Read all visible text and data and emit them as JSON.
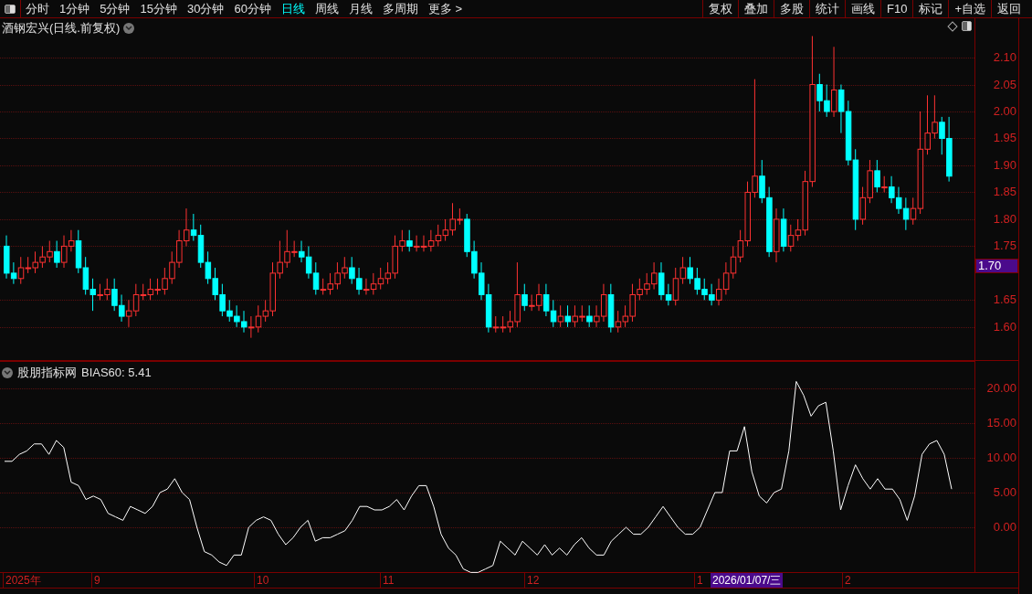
{
  "toolbar": {
    "periods": [
      {
        "label": "分时",
        "selected": false
      },
      {
        "label": "1分钟",
        "selected": false
      },
      {
        "label": "5分钟",
        "selected": false
      },
      {
        "label": "15分钟",
        "selected": false
      },
      {
        "label": "30分钟",
        "selected": false
      },
      {
        "label": "60分钟",
        "selected": false
      },
      {
        "label": "日线",
        "selected": true
      },
      {
        "label": "周线",
        "selected": false
      },
      {
        "label": "月线",
        "selected": false
      },
      {
        "label": "多周期",
        "selected": false
      },
      {
        "label": "更多 >",
        "selected": false
      }
    ],
    "actions": [
      "复权",
      "叠加",
      "多股",
      "统计",
      "画线",
      "F10",
      "标记",
      "+自选",
      "返回"
    ]
  },
  "price_pane": {
    "title": "酒钢宏兴(日线.前复权)",
    "current_price": "1.70",
    "chart_data": {
      "type": "candlestick",
      "grid": true,
      "ylim": [
        1.537,
        2.173
      ],
      "yticks": [
        {
          "value": 2.1,
          "label": "2.10"
        },
        {
          "value": 2.05,
          "label": "2.05"
        },
        {
          "value": 2.0,
          "label": "2.00"
        },
        {
          "value": 1.95,
          "label": "1.95"
        },
        {
          "value": 1.9,
          "label": "1.90"
        },
        {
          "value": 1.85,
          "label": "1.85"
        },
        {
          "value": 1.8,
          "label": "1.80"
        },
        {
          "value": 1.75,
          "label": "1.75"
        },
        {
          "value": 1.65,
          "label": "1.65"
        },
        {
          "value": 1.6,
          "label": "1.60"
        }
      ],
      "ohlc": [
        [
          1.75,
          1.77,
          1.69,
          1.7
        ],
        [
          1.7,
          1.72,
          1.68,
          1.69
        ],
        [
          1.69,
          1.73,
          1.68,
          1.71
        ],
        [
          1.71,
          1.73,
          1.7,
          1.71
        ],
        [
          1.71,
          1.74,
          1.7,
          1.72
        ],
        [
          1.72,
          1.75,
          1.71,
          1.73
        ],
        [
          1.73,
          1.76,
          1.72,
          1.74
        ],
        [
          1.74,
          1.76,
          1.71,
          1.72
        ],
        [
          1.72,
          1.77,
          1.71,
          1.75
        ],
        [
          1.75,
          1.78,
          1.74,
          1.76
        ],
        [
          1.76,
          1.78,
          1.7,
          1.71
        ],
        [
          1.71,
          1.73,
          1.66,
          1.67
        ],
        [
          1.67,
          1.69,
          1.63,
          1.66
        ],
        [
          1.66,
          1.68,
          1.65,
          1.66
        ],
        [
          1.66,
          1.69,
          1.65,
          1.67
        ],
        [
          1.67,
          1.69,
          1.63,
          1.64
        ],
        [
          1.64,
          1.66,
          1.61,
          1.62
        ],
        [
          1.62,
          1.65,
          1.6,
          1.63
        ],
        [
          1.63,
          1.68,
          1.62,
          1.66
        ],
        [
          1.66,
          1.68,
          1.65,
          1.66
        ],
        [
          1.66,
          1.69,
          1.65,
          1.67
        ],
        [
          1.67,
          1.69,
          1.66,
          1.67
        ],
        [
          1.67,
          1.71,
          1.66,
          1.69
        ],
        [
          1.69,
          1.74,
          1.68,
          1.72
        ],
        [
          1.72,
          1.78,
          1.71,
          1.76
        ],
        [
          1.76,
          1.82,
          1.75,
          1.78
        ],
        [
          1.78,
          1.81,
          1.76,
          1.77
        ],
        [
          1.77,
          1.79,
          1.71,
          1.72
        ],
        [
          1.72,
          1.74,
          1.68,
          1.69
        ],
        [
          1.69,
          1.71,
          1.65,
          1.66
        ],
        [
          1.66,
          1.68,
          1.62,
          1.63
        ],
        [
          1.63,
          1.65,
          1.61,
          1.62
        ],
        [
          1.62,
          1.64,
          1.6,
          1.61
        ],
        [
          1.61,
          1.63,
          1.59,
          1.6
        ],
        [
          1.6,
          1.62,
          1.58,
          1.6
        ],
        [
          1.6,
          1.64,
          1.59,
          1.62
        ],
        [
          1.62,
          1.65,
          1.61,
          1.63
        ],
        [
          1.63,
          1.72,
          1.62,
          1.7
        ],
        [
          1.7,
          1.76,
          1.69,
          1.72
        ],
        [
          1.72,
          1.78,
          1.71,
          1.74
        ],
        [
          1.74,
          1.76,
          1.73,
          1.74
        ],
        [
          1.74,
          1.76,
          1.72,
          1.73
        ],
        [
          1.73,
          1.75,
          1.69,
          1.7
        ],
        [
          1.7,
          1.72,
          1.66,
          1.67
        ],
        [
          1.67,
          1.69,
          1.66,
          1.67
        ],
        [
          1.67,
          1.7,
          1.66,
          1.68
        ],
        [
          1.68,
          1.72,
          1.67,
          1.7
        ],
        [
          1.7,
          1.73,
          1.69,
          1.71
        ],
        [
          1.71,
          1.73,
          1.68,
          1.69
        ],
        [
          1.69,
          1.71,
          1.66,
          1.67
        ],
        [
          1.67,
          1.69,
          1.66,
          1.67
        ],
        [
          1.67,
          1.7,
          1.66,
          1.68
        ],
        [
          1.68,
          1.71,
          1.67,
          1.69
        ],
        [
          1.69,
          1.72,
          1.68,
          1.7
        ],
        [
          1.7,
          1.77,
          1.69,
          1.75
        ],
        [
          1.75,
          1.78,
          1.74,
          1.76
        ],
        [
          1.76,
          1.78,
          1.74,
          1.75
        ],
        [
          1.75,
          1.77,
          1.74,
          1.75
        ],
        [
          1.75,
          1.77,
          1.74,
          1.75
        ],
        [
          1.75,
          1.78,
          1.74,
          1.76
        ],
        [
          1.76,
          1.79,
          1.75,
          1.77
        ],
        [
          1.77,
          1.8,
          1.76,
          1.78
        ],
        [
          1.78,
          1.83,
          1.77,
          1.8
        ],
        [
          1.8,
          1.82,
          1.79,
          1.8
        ],
        [
          1.8,
          1.81,
          1.73,
          1.74
        ],
        [
          1.74,
          1.76,
          1.69,
          1.7
        ],
        [
          1.7,
          1.72,
          1.65,
          1.66
        ],
        [
          1.66,
          1.68,
          1.59,
          1.6
        ],
        [
          1.6,
          1.62,
          1.59,
          1.6
        ],
        [
          1.6,
          1.62,
          1.59,
          1.6
        ],
        [
          1.6,
          1.63,
          1.59,
          1.61
        ],
        [
          1.61,
          1.72,
          1.6,
          1.66
        ],
        [
          1.66,
          1.68,
          1.63,
          1.64
        ],
        [
          1.64,
          1.66,
          1.63,
          1.64
        ],
        [
          1.64,
          1.68,
          1.63,
          1.66
        ],
        [
          1.66,
          1.68,
          1.62,
          1.63
        ],
        [
          1.63,
          1.65,
          1.6,
          1.61
        ],
        [
          1.61,
          1.64,
          1.6,
          1.62
        ],
        [
          1.62,
          1.64,
          1.6,
          1.61
        ],
        [
          1.61,
          1.64,
          1.6,
          1.62
        ],
        [
          1.62,
          1.64,
          1.61,
          1.62
        ],
        [
          1.62,
          1.64,
          1.6,
          1.61
        ],
        [
          1.61,
          1.64,
          1.6,
          1.62
        ],
        [
          1.62,
          1.68,
          1.61,
          1.66
        ],
        [
          1.66,
          1.68,
          1.59,
          1.6
        ],
        [
          1.6,
          1.63,
          1.59,
          1.61
        ],
        [
          1.61,
          1.64,
          1.6,
          1.62
        ],
        [
          1.62,
          1.68,
          1.61,
          1.66
        ],
        [
          1.66,
          1.69,
          1.65,
          1.67
        ],
        [
          1.67,
          1.7,
          1.66,
          1.68
        ],
        [
          1.68,
          1.72,
          1.67,
          1.7
        ],
        [
          1.7,
          1.72,
          1.65,
          1.66
        ],
        [
          1.66,
          1.68,
          1.64,
          1.65
        ],
        [
          1.65,
          1.71,
          1.64,
          1.69
        ],
        [
          1.69,
          1.73,
          1.68,
          1.71
        ],
        [
          1.71,
          1.73,
          1.68,
          1.69
        ],
        [
          1.69,
          1.71,
          1.66,
          1.67
        ],
        [
          1.67,
          1.69,
          1.65,
          1.66
        ],
        [
          1.66,
          1.68,
          1.64,
          1.65
        ],
        [
          1.65,
          1.69,
          1.64,
          1.67
        ],
        [
          1.67,
          1.72,
          1.66,
          1.7
        ],
        [
          1.7,
          1.75,
          1.69,
          1.73
        ],
        [
          1.73,
          1.78,
          1.72,
          1.76
        ],
        [
          1.76,
          1.87,
          1.75,
          1.85
        ],
        [
          1.85,
          2.06,
          1.84,
          1.88
        ],
        [
          1.88,
          1.91,
          1.83,
          1.84
        ],
        [
          1.84,
          1.86,
          1.73,
          1.74
        ],
        [
          1.74,
          1.82,
          1.72,
          1.8
        ],
        [
          1.8,
          1.82,
          1.74,
          1.75
        ],
        [
          1.75,
          1.79,
          1.74,
          1.77
        ],
        [
          1.77,
          1.8,
          1.76,
          1.78
        ],
        [
          1.78,
          1.89,
          1.77,
          1.87
        ],
        [
          1.87,
          2.14,
          1.86,
          2.05
        ],
        [
          2.05,
          2.07,
          2.0,
          2.02
        ],
        [
          2.02,
          2.05,
          1.99,
          2.0
        ],
        [
          2.0,
          2.12,
          1.99,
          2.04
        ],
        [
          2.04,
          2.05,
          1.96,
          2.0
        ],
        [
          2.0,
          2.02,
          1.9,
          1.91
        ],
        [
          1.91,
          1.93,
          1.78,
          1.8
        ],
        [
          1.8,
          1.86,
          1.79,
          1.84
        ],
        [
          1.84,
          1.91,
          1.83,
          1.89
        ],
        [
          1.89,
          1.91,
          1.85,
          1.86
        ],
        [
          1.86,
          1.88,
          1.85,
          1.86
        ],
        [
          1.86,
          1.88,
          1.83,
          1.84
        ],
        [
          1.84,
          1.86,
          1.81,
          1.82
        ],
        [
          1.82,
          1.84,
          1.78,
          1.8
        ],
        [
          1.8,
          1.84,
          1.79,
          1.82
        ],
        [
          1.82,
          2.0,
          1.81,
          1.93
        ],
        [
          1.93,
          2.03,
          1.92,
          1.96
        ],
        [
          1.96,
          2.03,
          1.95,
          1.98
        ],
        [
          1.98,
          1.99,
          1.92,
          1.95
        ],
        [
          1.95,
          1.99,
          1.87,
          1.88
        ]
      ]
    }
  },
  "indicator_pane": {
    "title": "股朋指标网",
    "reading": "BIAS60: 5.41",
    "chart_data": {
      "type": "line",
      "grid": true,
      "ylim": [
        -6.58,
        23.95
      ],
      "yticks": [
        {
          "value": 20,
          "label": "20.00"
        },
        {
          "value": 15,
          "label": "15.00"
        },
        {
          "value": 10,
          "label": "10.00"
        },
        {
          "value": 5,
          "label": "5.00"
        },
        {
          "value": 0,
          "label": "0.00"
        }
      ],
      "series": [
        {
          "color": "#ffffff",
          "values": [
            9.5,
            9.5,
            10.5,
            11,
            12,
            12,
            10.5,
            12.5,
            11.5,
            6.5,
            6,
            4,
            4.5,
            4,
            2,
            1.5,
            1,
            3,
            2.5,
            2,
            3,
            5,
            5.5,
            7,
            5,
            4,
            0,
            -3.5,
            -4,
            -5,
            -5.5,
            -4,
            -4,
            0,
            1,
            1.5,
            1,
            -1,
            -2.5,
            -1.5,
            0,
            1,
            -2,
            -1.5,
            -1.5,
            -1,
            -0.5,
            1,
            3,
            3,
            2.5,
            2.5,
            3,
            4,
            2.5,
            4.5,
            6,
            6,
            3,
            -1,
            -3,
            -4,
            -6,
            -6.5,
            -6.5,
            -6,
            -5.5,
            -2,
            -3,
            -4,
            -2,
            -3,
            -4,
            -2.5,
            -4,
            -3,
            -4,
            -2.5,
            -1.5,
            -3,
            -4,
            -4,
            -2,
            -1,
            0,
            -1,
            -1,
            0,
            1.5,
            3,
            1.5,
            0,
            -1,
            -1,
            0,
            2.5,
            5,
            5,
            11,
            11,
            14.5,
            8,
            4.5,
            3.5,
            5,
            5.5,
            11,
            21,
            19,
            16,
            17.5,
            18,
            11,
            2.5,
            6,
            9,
            7,
            5.5,
            7,
            5.5,
            5.5,
            4,
            1,
            4.5,
            10.5,
            12,
            12.5,
            10.5,
            5.5
          ]
        }
      ]
    }
  },
  "date_axis": [
    {
      "label": "2025年",
      "kind": "month"
    },
    {
      "label": "9",
      "kind": "month"
    },
    {
      "label": "10",
      "kind": "month"
    },
    {
      "label": "11",
      "kind": "month"
    },
    {
      "label": "12",
      "kind": "month"
    },
    {
      "label": "1",
      "kind": "month"
    },
    {
      "label": "2026/01/07/三",
      "kind": "cursor"
    },
    {
      "label": "2",
      "kind": "month"
    }
  ]
}
